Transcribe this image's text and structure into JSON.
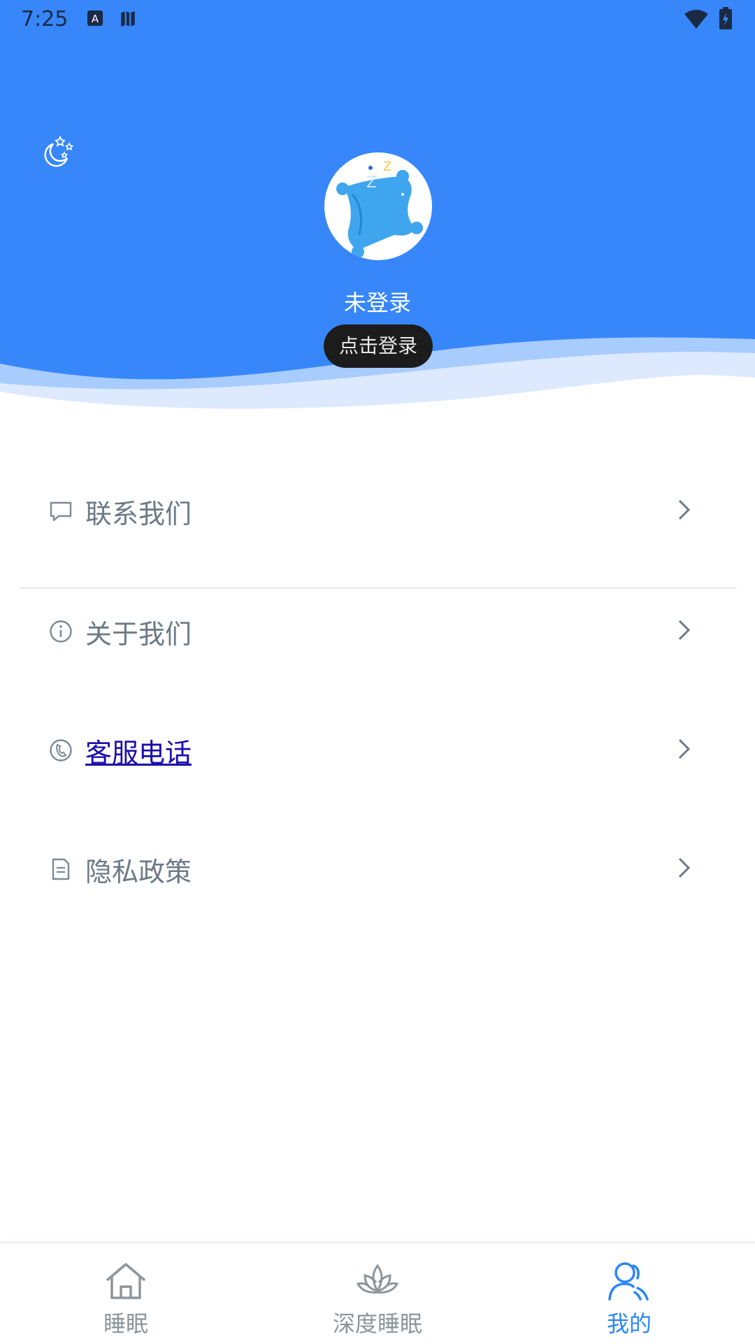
{
  "status_bar": {
    "time": "7:25"
  },
  "profile": {
    "user_name": "未登录",
    "login_button": "点击登录"
  },
  "menu": {
    "items": [
      {
        "label": "联系我们",
        "icon": "chat-icon"
      },
      {
        "label": "关于我们",
        "icon": "info-icon"
      },
      {
        "label": "客服电话",
        "icon": "phone-icon"
      },
      {
        "label": "隐私政策",
        "icon": "document-icon"
      }
    ]
  },
  "bottom_nav": {
    "tabs": [
      {
        "label": "睡眠",
        "icon": "home-icon"
      },
      {
        "label": "深度睡眠",
        "icon": "lotus-icon"
      },
      {
        "label": "我的",
        "icon": "user-icon",
        "active": true
      }
    ]
  },
  "colors": {
    "header_blue": "#3787fb",
    "active_tab": "#2b86f6",
    "menu_text": "#6c7a87",
    "link_text": "#1a0dab"
  }
}
